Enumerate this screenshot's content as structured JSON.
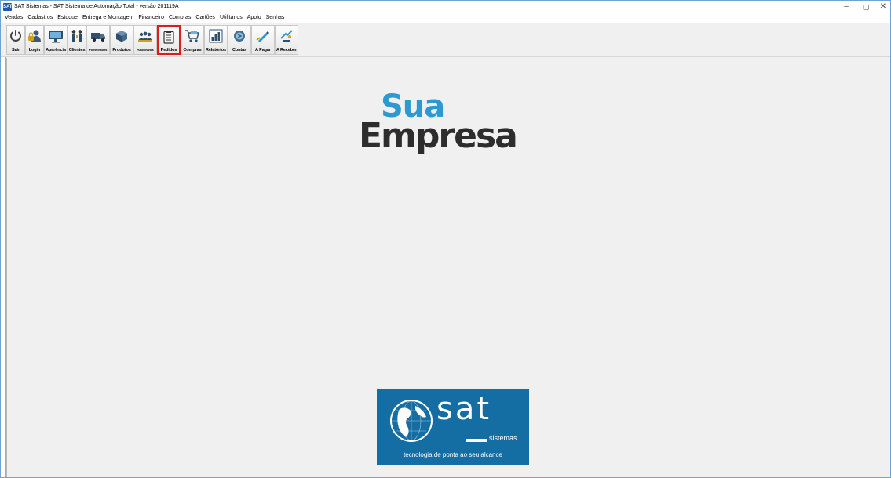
{
  "window": {
    "app_icon_text": "SAT",
    "title": "SAT Sistemas - SAT Sistema de Automação Total - versão 201119A",
    "controls": {
      "minimize": "–",
      "maximize": "▢",
      "close": "✕"
    }
  },
  "menu": [
    "Vendas",
    "Cadastros",
    "Estoque",
    "Entrega e Montagem",
    "Financeiro",
    "Compras",
    "Cartões",
    "Utilitários",
    "Apoio",
    "Senhas"
  ],
  "toolbar": [
    {
      "label": "Sair",
      "icon": "power-icon"
    },
    {
      "label": "Login",
      "icon": "user-lock-icon"
    },
    {
      "label": "Aparência",
      "icon": "monitor-icon"
    },
    {
      "label": "Clientes",
      "icon": "clients-icon"
    },
    {
      "label": "Fornecedores",
      "icon": "truck-icon"
    },
    {
      "label": "Produtos",
      "icon": "box-icon"
    },
    {
      "label": "Funcionários",
      "icon": "team-icon"
    },
    {
      "label": "Pedidos",
      "icon": "clipboard-icon",
      "active": true
    },
    {
      "label": "Compras",
      "icon": "cart-icon"
    },
    {
      "label": "Relatórios",
      "icon": "bar-chart-icon"
    },
    {
      "label": "Contas",
      "icon": "coins-icon"
    },
    {
      "label": "A Pagar",
      "icon": "pen-pay-icon"
    },
    {
      "label": "A Receber",
      "icon": "receive-icon"
    }
  ],
  "logo_top": {
    "line1": "Sua",
    "line2": "Empresa"
  },
  "logo_bottom": {
    "brand": "sat",
    "sub": "sistemas",
    "tagline": "tecnologia de ponta ao seu alcance"
  },
  "colors": {
    "accent": "#2c9ad1",
    "dark_text": "#2d2d2d",
    "sat_blue": "#156ea3",
    "active_border": "#e01b1b"
  }
}
